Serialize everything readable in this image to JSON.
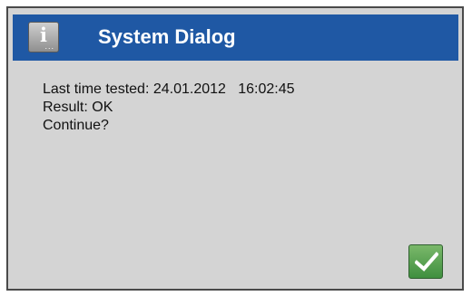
{
  "dialog": {
    "title": "System Dialog",
    "icon": "info-icon",
    "icon_glyph": "i",
    "icon_dots": "...",
    "message_lines": [
      "Last time tested: 24.01.2012   16:02:45",
      "Result: OK",
      "Continue?"
    ],
    "confirm_icon": "checkmark-icon",
    "colors": {
      "titlebar": "#1f58a4",
      "background": "#d4d4d4",
      "confirm": "#4f9a4a"
    }
  }
}
